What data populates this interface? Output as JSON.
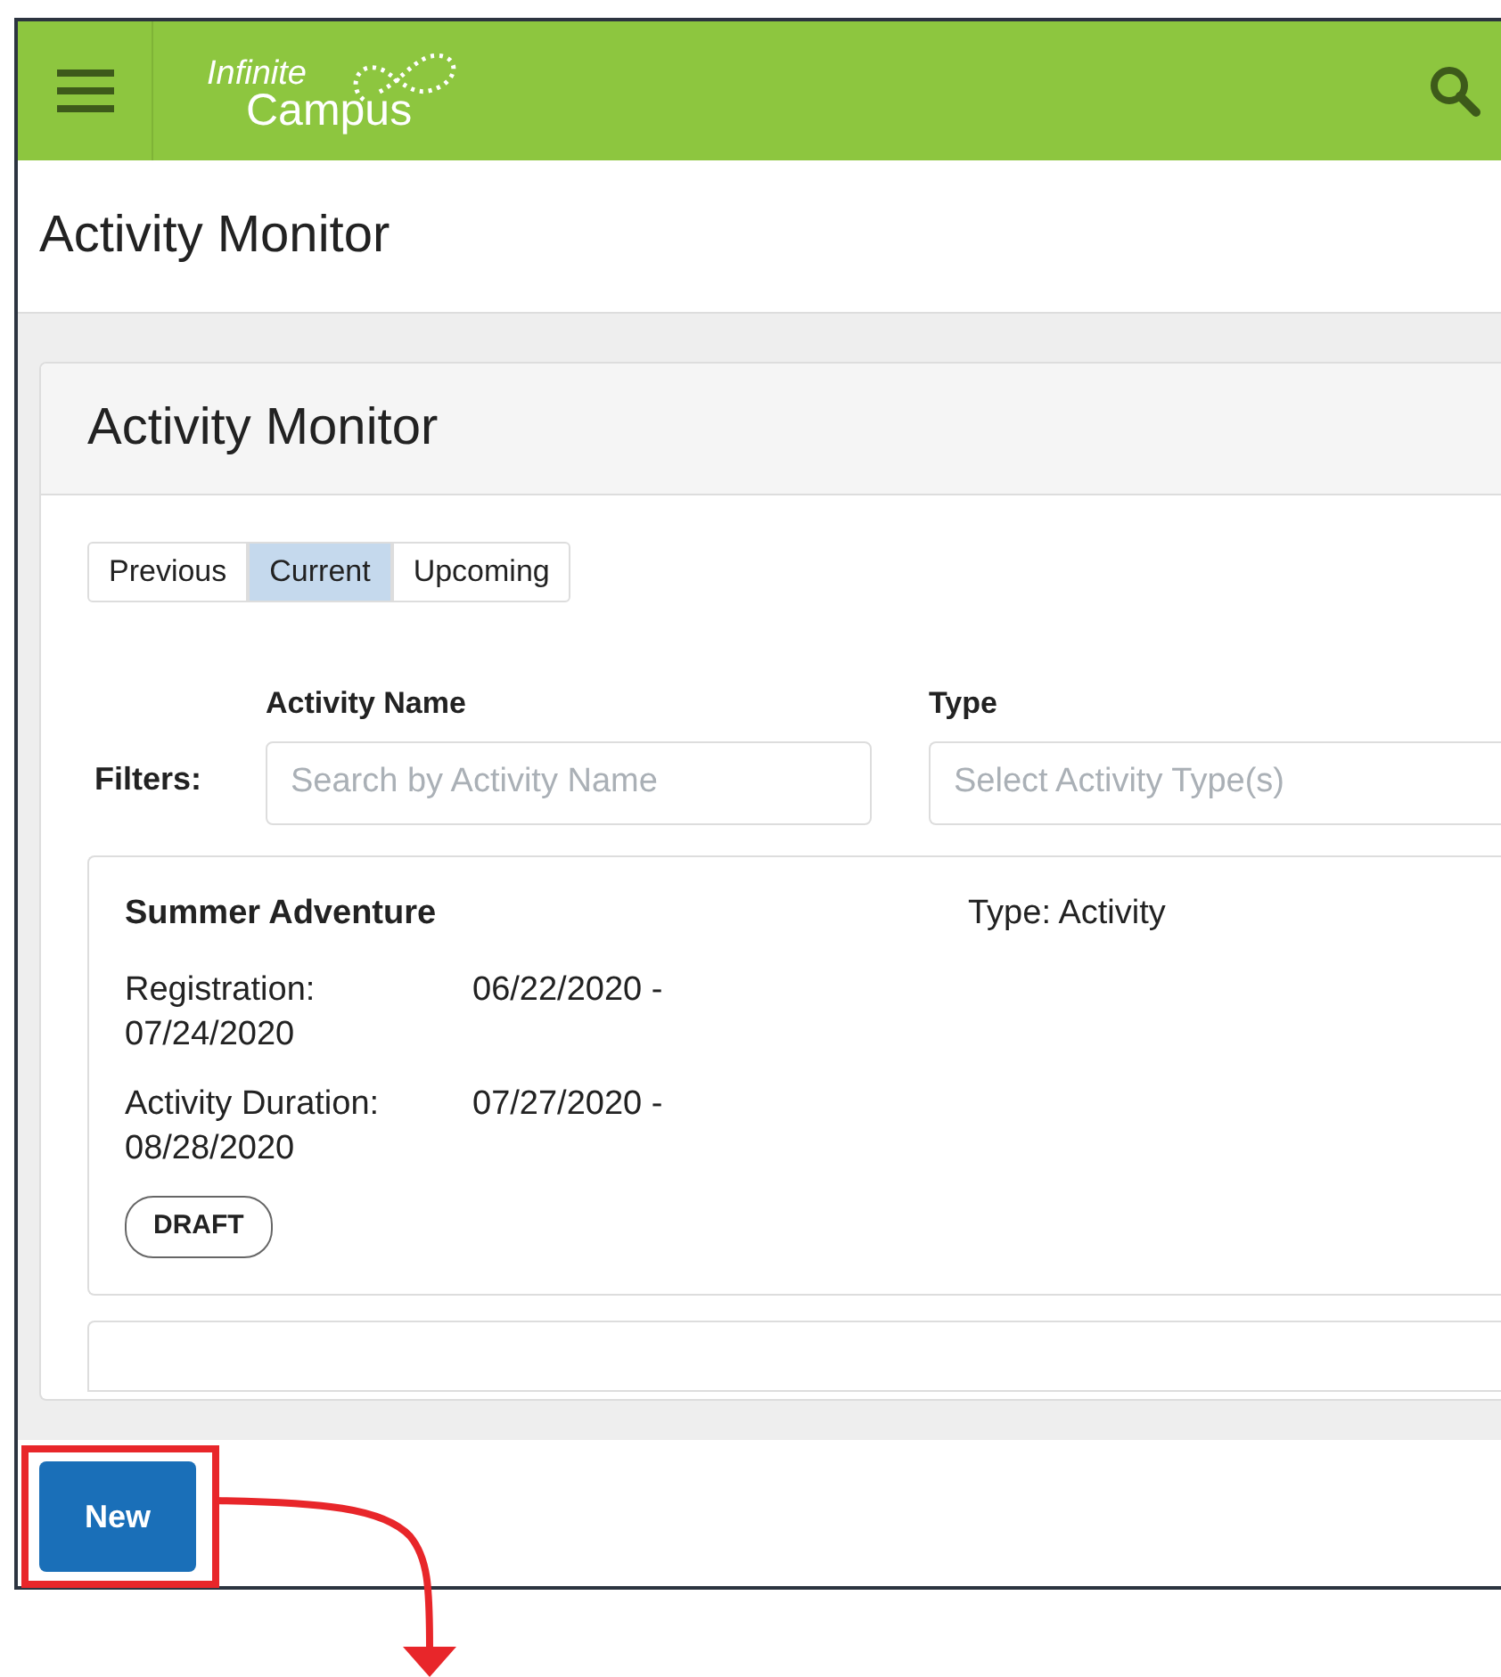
{
  "header": {
    "logo": {
      "line1": "Infinite",
      "line2": "Campus"
    }
  },
  "page_title": "Activity Monitor",
  "panel": {
    "title": "Activity Monitor",
    "tabs": [
      {
        "label": "Previous",
        "selected": false
      },
      {
        "label": "Current",
        "selected": true
      },
      {
        "label": "Upcoming",
        "selected": false
      }
    ],
    "filters": {
      "label": "Filters:",
      "fields": [
        {
          "label": "Activity Name",
          "placeholder": "Search by Activity Name"
        },
        {
          "label": "Type",
          "placeholder": "Select Activity Type(s)"
        }
      ]
    },
    "activities": [
      {
        "name": "Summer Adventure",
        "type": "Type: Activity",
        "dates": [
          {
            "label": "Registration:",
            "value": "06/22/2020 - 07/24/2020"
          },
          {
            "label": "Activity Duration:",
            "value": "07/27/2020 - 08/28/2020"
          }
        ],
        "status": "DRAFT"
      }
    ]
  },
  "footer": {
    "button": "New"
  }
}
